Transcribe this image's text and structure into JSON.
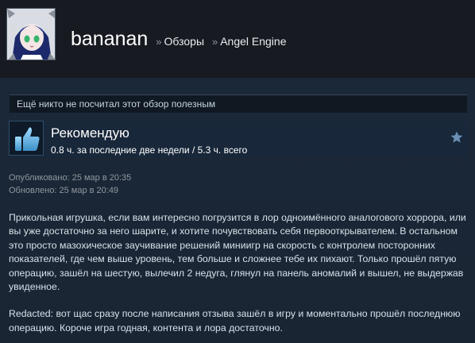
{
  "header": {
    "username": "bananan",
    "separator": "»",
    "crumb1": "Обзоры",
    "crumb2": "Angel Engine"
  },
  "review": {
    "helpful_text": "Ещё никто не посчитал этот обзор полезным",
    "recommend_label": "Рекомендую",
    "hours_text": "0.8 ч. за последние две недели / 5.3 ч. всего",
    "posted": "Опубликовано: 25 мар в 20:35",
    "updated": "Обновлено: 25 мар в 20:49",
    "paragraph1": "Прикольная игрушка, если вам интересно погрузится в лор одноимённого аналогового хоррора, или вы уже достаточно за него шарите, и хотите почувствовать себя первооткрывателем. В остальном это просто мазохическое заучивание решений миниигр на скорость с контролем посторонних показателей, где чем выше уровень, тем больше и сложнее тебе их пихают. Только прошёл пятую операцию, зашёл на шестую, вылечил 2 недуга, глянул на панель аномалий и вышел, не выдержав увиденное.",
    "paragraph2": "Redacted: вот щас сразу после написания отзыва зашёл в игру и моментально прошёл последнюю операцию. Короче игра годная, контента и лора достаточно."
  },
  "icons": {
    "thumb": "thumbs-up-icon",
    "star": "star-icon"
  },
  "colors": {
    "background": "#1b2838",
    "header_bg": "#171a21",
    "thumb_blue": "#66c0f4"
  }
}
